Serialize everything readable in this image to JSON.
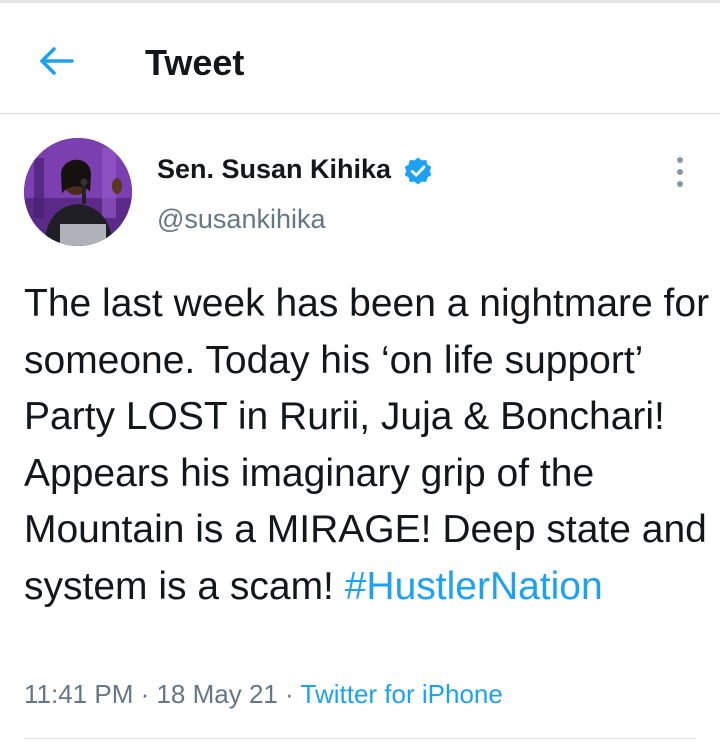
{
  "header": {
    "title": "Tweet",
    "back_icon": "arrow-left-icon",
    "accent_color": "#1da1f2"
  },
  "author": {
    "name": "Sen. Susan Kihika",
    "handle": "@susankihika",
    "verified": true,
    "verified_icon": "verified-badge-icon"
  },
  "tweet": {
    "text": "The last week has been a nightmare for someone. Today his ‘on life support’ Party LOST in Rurii, Juja & Bonchari! Appears his imaginary grip of the Mountain is a MIRAGE! Deep state and system is a scam! ",
    "hashtag": "#HustlerNation"
  },
  "meta": {
    "time": "11:41 PM",
    "separator": " · ",
    "date": "18 May 21",
    "source": "Twitter for iPhone"
  },
  "more_icon": "more-vertical-icon"
}
